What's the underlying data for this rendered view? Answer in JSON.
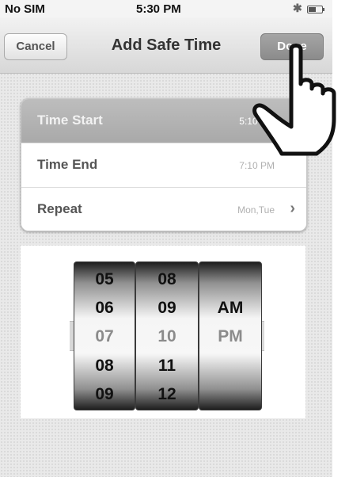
{
  "status_bar": {
    "carrier": "No SIM",
    "time": "5:30 PM",
    "bluetooth_icon": "bluetooth-icon",
    "battery_icon": "battery-icon"
  },
  "nav": {
    "title": "Add Safe Time",
    "cancel_label": "Cancel",
    "done_label": "Done"
  },
  "rows": [
    {
      "label": "Time Start",
      "value": "5:10 PM",
      "selected": true
    },
    {
      "label": "Time End",
      "value": "7:10 PM"
    },
    {
      "label": "Repeat",
      "value": "Mon,Tue",
      "chevron": "›"
    }
  ],
  "picker": {
    "hours": [
      "05",
      "06",
      "07",
      "08",
      "09"
    ],
    "minutes": [
      "08",
      "09",
      "10",
      "11",
      "12"
    ],
    "ampm": [
      "",
      "AM",
      "PM",
      "",
      ""
    ],
    "selected_index": 2
  },
  "overlay": {
    "icon": "pointing-hand-icon"
  },
  "colors": {
    "selected_row": "#b3b3b3",
    "done_button": "#999999"
  }
}
